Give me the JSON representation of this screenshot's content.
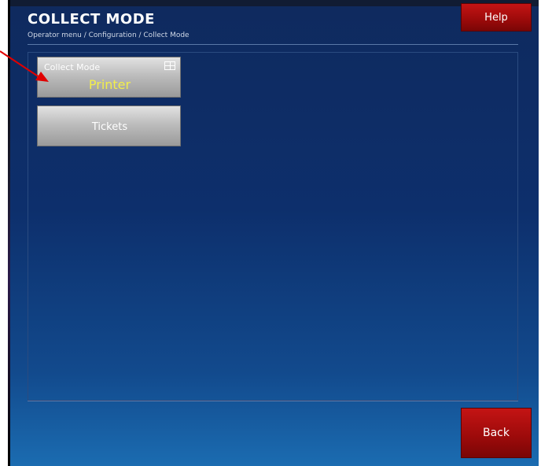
{
  "header": {
    "title": "COLLECT MODE",
    "breadcrumb": "Operator menu / Configuration / Collect Mode",
    "help_label": "Help"
  },
  "tiles": {
    "collect_mode": {
      "label": "Collect Mode",
      "value": "Printer",
      "icon": "keyboard-icon"
    },
    "tickets": {
      "label": "Tickets"
    }
  },
  "footer": {
    "back_label": "Back"
  },
  "colors": {
    "background_top": "#0f2a5e",
    "background_bottom": "#1b6cb1",
    "accent_button": "#c41414",
    "value_text": "#f2ee4a",
    "annotation_arrow": "#e00000"
  }
}
